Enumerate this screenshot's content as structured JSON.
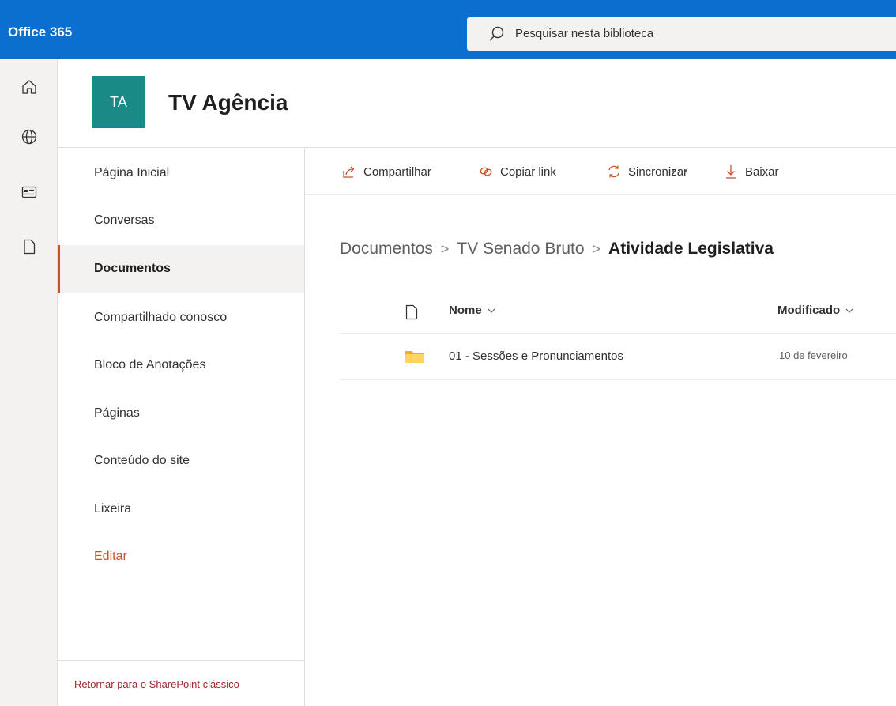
{
  "suite": {
    "brand": "Office 365",
    "search_placeholder": "Pesquisar nesta biblioteca",
    "accent_color": "#0b6fd0"
  },
  "rail": {
    "icons": [
      "home-icon",
      "globe-icon",
      "news-icon",
      "document-icon"
    ]
  },
  "site": {
    "logo_initials": "TA",
    "title": "TV Agência",
    "logo_color": "#1a8a86"
  },
  "nav": {
    "items": [
      {
        "label": "Página Inicial"
      },
      {
        "label": "Conversas"
      },
      {
        "label": "Documentos"
      },
      {
        "label": "Compartilhado conosco"
      },
      {
        "label": "Bloco de Anotações"
      },
      {
        "label": "Páginas"
      },
      {
        "label": "Conteúdo do site"
      },
      {
        "label": "Lixeira"
      },
      {
        "label": "Editar"
      }
    ],
    "selected": "Documentos",
    "classic_link": "Retornar para o SharePoint clássico"
  },
  "commands": {
    "share": "Compartilhar",
    "copy_link": "Copiar link",
    "sync": "Sincronizar",
    "download": "Baixar",
    "more": "···"
  },
  "breadcrumb": {
    "items": [
      "Documentos",
      "TV Senado Bruto",
      "Atividade Legislativa"
    ],
    "separator": ">"
  },
  "list": {
    "columns": {
      "name": "Nome",
      "modified": "Modificado"
    },
    "rows": [
      {
        "name": "01 - Sessões e Pronunciamentos",
        "modified": "10 de fevereiro",
        "icon": "folder-icon"
      }
    ]
  }
}
